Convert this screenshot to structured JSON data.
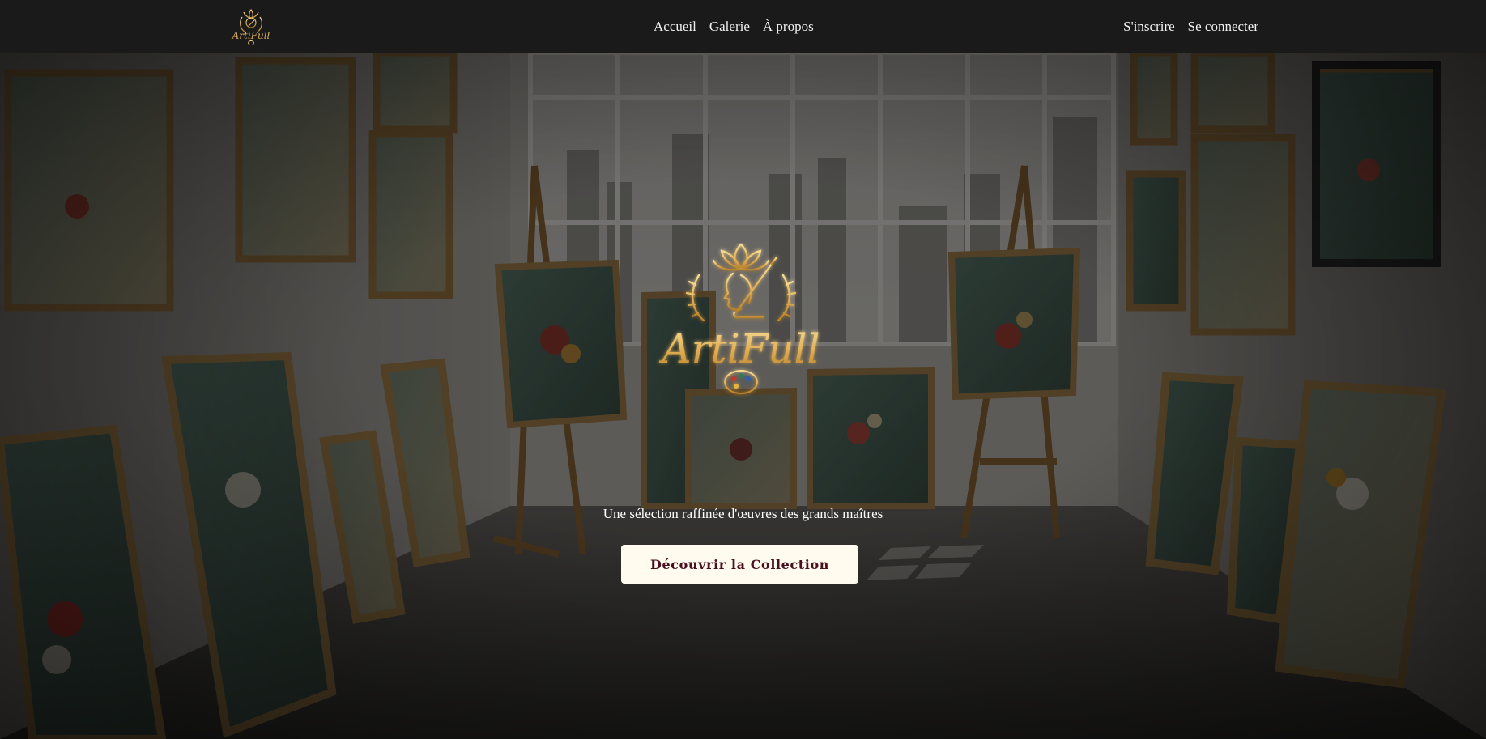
{
  "brand": {
    "name": "ArtiFull"
  },
  "nav": {
    "center_links": [
      {
        "label": "Accueil"
      },
      {
        "label": "Galerie"
      },
      {
        "label": "À propos"
      }
    ],
    "right_links": [
      {
        "label": "S'inscrire"
      },
      {
        "label": "Se connecter"
      }
    ]
  },
  "hero": {
    "tagline": "Une sélection raffinée d'œuvres des grands maîtres",
    "cta_label": "Découvrir la Collection"
  },
  "colors": {
    "navbar": "#1a1a1a",
    "gold": "#d9a94a",
    "cta_background": "#fffbef",
    "cta_text": "#4a1020"
  }
}
